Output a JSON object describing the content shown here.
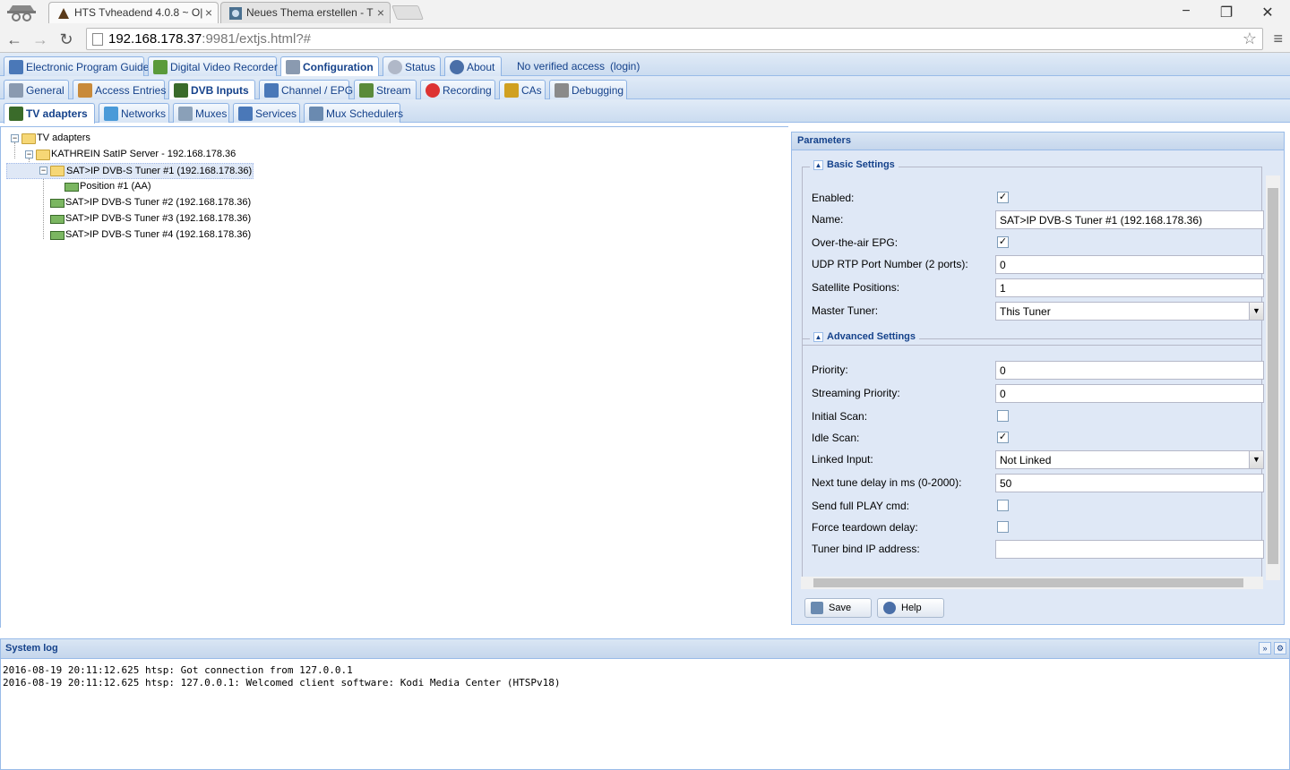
{
  "browser": {
    "tabs": [
      {
        "title": "HTS Tvheadend 4.0.8 ~ O|",
        "close": "×"
      },
      {
        "title": "Neues Thema erstellen - T",
        "close": "×"
      }
    ],
    "url_host": "192.168.178.37",
    "url_rest": ":9981/extjs.html?#",
    "window": {
      "minimize": "−",
      "restore": "❐",
      "close": "✕"
    },
    "nav": {
      "back": "←",
      "forward": "→",
      "reload": "↻",
      "star": "☆",
      "menu": "≡"
    }
  },
  "top_tabs": [
    {
      "label": "Electronic Program Guide",
      "icon": "epg-icon"
    },
    {
      "label": "Digital Video Recorder",
      "icon": "download-icon"
    },
    {
      "label": "Configuration",
      "icon": "wrench-icon"
    },
    {
      "label": "Status",
      "icon": "eye-icon"
    },
    {
      "label": "About",
      "icon": "info-icon"
    }
  ],
  "access": {
    "text": "No verified access",
    "login": "(login)"
  },
  "config_tabs": [
    {
      "label": "General"
    },
    {
      "label": "Access Entries"
    },
    {
      "label": "DVB Inputs"
    },
    {
      "label": "Channel / EPG"
    },
    {
      "label": "Stream"
    },
    {
      "label": "Recording"
    },
    {
      "label": "CAs"
    },
    {
      "label": "Debugging"
    }
  ],
  "dvb_tabs": [
    {
      "label": "TV adapters"
    },
    {
      "label": "Networks"
    },
    {
      "label": "Muxes"
    },
    {
      "label": "Services"
    },
    {
      "label": "Mux Schedulers"
    }
  ],
  "tree": {
    "root": "TV adapters",
    "server": "KATHREIN SatIP Server - 192.168.178.36",
    "tuner1": "SAT>IP DVB-S Tuner #1 (192.168.178.36)",
    "position1": "Position #1 (AA)",
    "tuner2": "SAT>IP DVB-S Tuner #2 (192.168.178.36)",
    "tuner3": "SAT>IP DVB-S Tuner #3 (192.168.178.36)",
    "tuner4": "SAT>IP DVB-S Tuner #4 (192.168.178.36)"
  },
  "params": {
    "title": "Parameters",
    "basic": {
      "legend": "Basic Settings",
      "enabled_label": "Enabled:",
      "enabled": "✓",
      "name_label": "Name:",
      "name": "SAT>IP DVB-S Tuner #1 (192.168.178.36)",
      "epg_label": "Over-the-air EPG:",
      "epg": "✓",
      "udp_label": "UDP RTP Port Number (2 ports):",
      "udp": "0",
      "satpos_label": "Satellite Positions:",
      "satpos": "1",
      "master_label": "Master Tuner:",
      "master": "This Tuner"
    },
    "advanced": {
      "legend": "Advanced Settings",
      "priority_label": "Priority:",
      "priority": "0",
      "spriority_label": "Streaming Priority:",
      "spriority": "0",
      "initscan_label": "Initial Scan:",
      "initscan": "",
      "idlescan_label": "Idle Scan:",
      "idlescan": "✓",
      "linked_label": "Linked Input:",
      "linked": "Not Linked",
      "tunedelay_label": "Next tune delay in ms (0-2000):",
      "tunedelay": "50",
      "fullplay_label": "Send full PLAY cmd:",
      "fullplay": "",
      "teardown_label": "Force teardown delay:",
      "teardown": "",
      "bindip_label": "Tuner bind IP address:",
      "bindip": ""
    },
    "save": "Save",
    "help": "Help"
  },
  "syslog": {
    "title": "System log",
    "lines": [
      "2016-08-19 20:11:12.625 htsp: Got connection from 127.0.0.1",
      "2016-08-19 20:11:12.625 htsp: 127.0.0.1: Welcomed client software: Kodi Media Center (HTSPv18)"
    ]
  },
  "colors": {
    "ext_blue": "#15428b",
    "panel_bg": "#dfe8f6",
    "border": "#99bbe8"
  }
}
